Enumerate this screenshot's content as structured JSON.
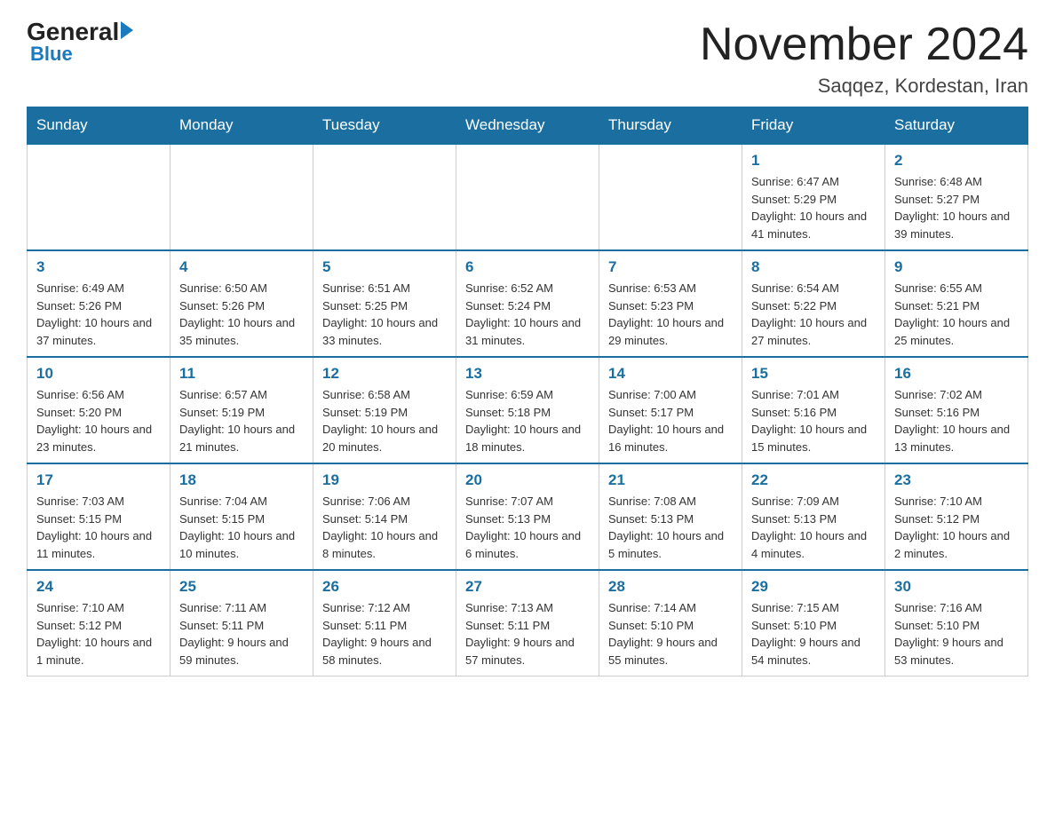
{
  "header": {
    "logo_general": "General",
    "logo_blue": "Blue",
    "title": "November 2024",
    "subtitle": "Saqqez, Kordestan, Iran"
  },
  "weekdays": [
    "Sunday",
    "Monday",
    "Tuesday",
    "Wednesday",
    "Thursday",
    "Friday",
    "Saturday"
  ],
  "weeks": [
    [
      {
        "day": "",
        "info": ""
      },
      {
        "day": "",
        "info": ""
      },
      {
        "day": "",
        "info": ""
      },
      {
        "day": "",
        "info": ""
      },
      {
        "day": "",
        "info": ""
      },
      {
        "day": "1",
        "info": "Sunrise: 6:47 AM\nSunset: 5:29 PM\nDaylight: 10 hours and 41 minutes."
      },
      {
        "day": "2",
        "info": "Sunrise: 6:48 AM\nSunset: 5:27 PM\nDaylight: 10 hours and 39 minutes."
      }
    ],
    [
      {
        "day": "3",
        "info": "Sunrise: 6:49 AM\nSunset: 5:26 PM\nDaylight: 10 hours and 37 minutes."
      },
      {
        "day": "4",
        "info": "Sunrise: 6:50 AM\nSunset: 5:26 PM\nDaylight: 10 hours and 35 minutes."
      },
      {
        "day": "5",
        "info": "Sunrise: 6:51 AM\nSunset: 5:25 PM\nDaylight: 10 hours and 33 minutes."
      },
      {
        "day": "6",
        "info": "Sunrise: 6:52 AM\nSunset: 5:24 PM\nDaylight: 10 hours and 31 minutes."
      },
      {
        "day": "7",
        "info": "Sunrise: 6:53 AM\nSunset: 5:23 PM\nDaylight: 10 hours and 29 minutes."
      },
      {
        "day": "8",
        "info": "Sunrise: 6:54 AM\nSunset: 5:22 PM\nDaylight: 10 hours and 27 minutes."
      },
      {
        "day": "9",
        "info": "Sunrise: 6:55 AM\nSunset: 5:21 PM\nDaylight: 10 hours and 25 minutes."
      }
    ],
    [
      {
        "day": "10",
        "info": "Sunrise: 6:56 AM\nSunset: 5:20 PM\nDaylight: 10 hours and 23 minutes."
      },
      {
        "day": "11",
        "info": "Sunrise: 6:57 AM\nSunset: 5:19 PM\nDaylight: 10 hours and 21 minutes."
      },
      {
        "day": "12",
        "info": "Sunrise: 6:58 AM\nSunset: 5:19 PM\nDaylight: 10 hours and 20 minutes."
      },
      {
        "day": "13",
        "info": "Sunrise: 6:59 AM\nSunset: 5:18 PM\nDaylight: 10 hours and 18 minutes."
      },
      {
        "day": "14",
        "info": "Sunrise: 7:00 AM\nSunset: 5:17 PM\nDaylight: 10 hours and 16 minutes."
      },
      {
        "day": "15",
        "info": "Sunrise: 7:01 AM\nSunset: 5:16 PM\nDaylight: 10 hours and 15 minutes."
      },
      {
        "day": "16",
        "info": "Sunrise: 7:02 AM\nSunset: 5:16 PM\nDaylight: 10 hours and 13 minutes."
      }
    ],
    [
      {
        "day": "17",
        "info": "Sunrise: 7:03 AM\nSunset: 5:15 PM\nDaylight: 10 hours and 11 minutes."
      },
      {
        "day": "18",
        "info": "Sunrise: 7:04 AM\nSunset: 5:15 PM\nDaylight: 10 hours and 10 minutes."
      },
      {
        "day": "19",
        "info": "Sunrise: 7:06 AM\nSunset: 5:14 PM\nDaylight: 10 hours and 8 minutes."
      },
      {
        "day": "20",
        "info": "Sunrise: 7:07 AM\nSunset: 5:13 PM\nDaylight: 10 hours and 6 minutes."
      },
      {
        "day": "21",
        "info": "Sunrise: 7:08 AM\nSunset: 5:13 PM\nDaylight: 10 hours and 5 minutes."
      },
      {
        "day": "22",
        "info": "Sunrise: 7:09 AM\nSunset: 5:13 PM\nDaylight: 10 hours and 4 minutes."
      },
      {
        "day": "23",
        "info": "Sunrise: 7:10 AM\nSunset: 5:12 PM\nDaylight: 10 hours and 2 minutes."
      }
    ],
    [
      {
        "day": "24",
        "info": "Sunrise: 7:10 AM\nSunset: 5:12 PM\nDaylight: 10 hours and 1 minute."
      },
      {
        "day": "25",
        "info": "Sunrise: 7:11 AM\nSunset: 5:11 PM\nDaylight: 9 hours and 59 minutes."
      },
      {
        "day": "26",
        "info": "Sunrise: 7:12 AM\nSunset: 5:11 PM\nDaylight: 9 hours and 58 minutes."
      },
      {
        "day": "27",
        "info": "Sunrise: 7:13 AM\nSunset: 5:11 PM\nDaylight: 9 hours and 57 minutes."
      },
      {
        "day": "28",
        "info": "Sunrise: 7:14 AM\nSunset: 5:10 PM\nDaylight: 9 hours and 55 minutes."
      },
      {
        "day": "29",
        "info": "Sunrise: 7:15 AM\nSunset: 5:10 PM\nDaylight: 9 hours and 54 minutes."
      },
      {
        "day": "30",
        "info": "Sunrise: 7:16 AM\nSunset: 5:10 PM\nDaylight: 9 hours and 53 minutes."
      }
    ]
  ]
}
